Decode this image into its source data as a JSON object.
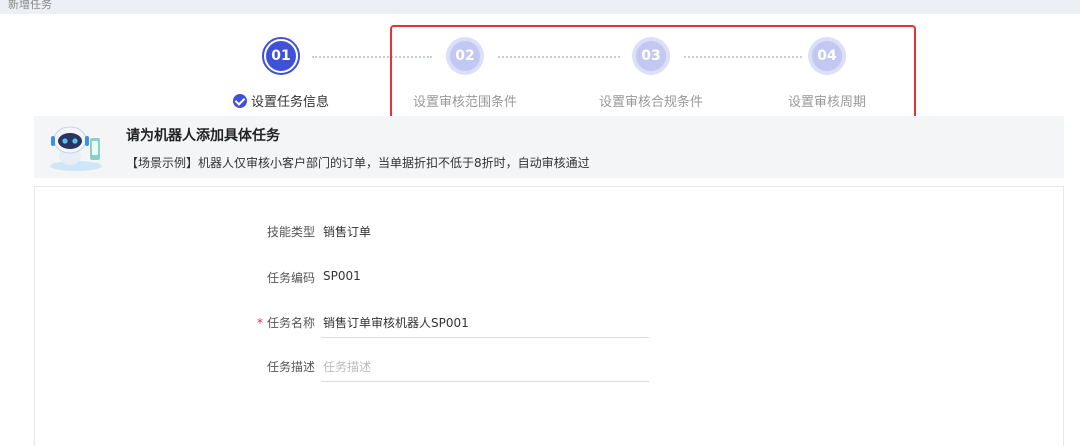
{
  "topbar": {
    "title": "新增任务"
  },
  "steps": [
    {
      "number": "01",
      "label": "设置任务信息"
    },
    {
      "number": "02",
      "label": "设置审核范围条件"
    },
    {
      "number": "03",
      "label": "设置审核合规条件"
    },
    {
      "number": "04",
      "label": "设置审核周期"
    }
  ],
  "banner": {
    "title": "请为机器人添加具体任务",
    "description": "【场景示例】机器人仅审核小客户部门的订单，当单据折扣不低于8折时，自动审核通过"
  },
  "form": {
    "skill_type": {
      "label": "技能类型",
      "value": "销售订单"
    },
    "task_code": {
      "label": "任务编码",
      "value": "SP001"
    },
    "task_name": {
      "required_mark": "*",
      "label": "任务名称",
      "value": "销售订单审核机器人SP001"
    },
    "task_desc": {
      "label": "任务描述",
      "placeholder": "任务描述"
    }
  },
  "colors": {
    "accent": "#3f51d9",
    "highlight": "#e8323a"
  }
}
